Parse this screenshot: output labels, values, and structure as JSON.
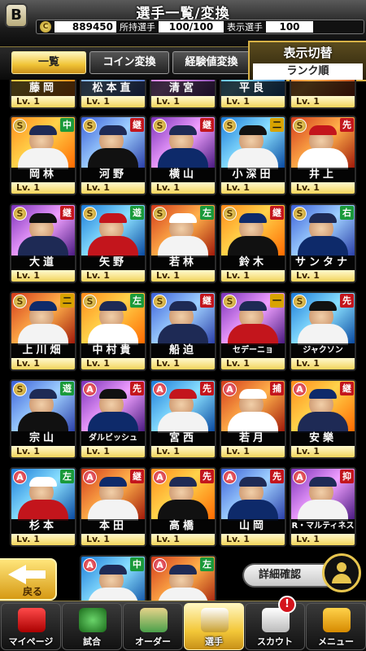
{
  "header": {
    "logo": "B",
    "title": "選手一覧/変換",
    "coins": "889450",
    "owned_label": "所持選手",
    "owned_value": "100/100",
    "shown_label": "表示選手",
    "shown_value": "100"
  },
  "tabs": [
    {
      "label": "一覧",
      "active": true
    },
    {
      "label": "コイン変換",
      "active": false
    },
    {
      "label": "経験値変換",
      "active": false
    }
  ],
  "display": {
    "title": "表示切替",
    "value": "ランク順"
  },
  "top_partial_row": [
    {
      "name": "藤岡",
      "lv": "Lv. 1"
    },
    {
      "name": "松本直",
      "lv": "Lv. 1"
    },
    {
      "name": "清宮",
      "lv": "Lv. 1"
    },
    {
      "name": "平良",
      "lv": "Lv. 1"
    },
    {
      "name": "",
      "lv": "Lv. 1"
    }
  ],
  "cards": [
    [
      {
        "rank": "S",
        "pos": "中",
        "name": "岡林",
        "lv": "Lv. 1"
      },
      {
        "rank": "S",
        "pos": "継",
        "name": "河野",
        "lv": "Lv. 1"
      },
      {
        "rank": "S",
        "pos": "継",
        "name": "横山",
        "lv": "Lv. 1"
      },
      {
        "rank": "S",
        "pos": "二",
        "name": "小深田",
        "lv": "Lv. 1"
      },
      {
        "rank": "S",
        "pos": "先",
        "name": "井上",
        "lv": "Lv. 1"
      }
    ],
    [
      {
        "rank": "S",
        "pos": "継",
        "name": "大道",
        "lv": "Lv. 1"
      },
      {
        "rank": "S",
        "pos": "遊",
        "name": "矢野",
        "lv": "Lv. 1"
      },
      {
        "rank": "S",
        "pos": "左",
        "name": "若林",
        "lv": "Lv. 1"
      },
      {
        "rank": "S",
        "pos": "継",
        "name": "鈴木",
        "lv": "Lv. 1"
      },
      {
        "rank": "S",
        "pos": "右",
        "name": "サンタナ",
        "lv": "Lv. 1"
      }
    ],
    [
      {
        "rank": "S",
        "pos": "二",
        "name": "上川畑",
        "lv": "Lv. 1"
      },
      {
        "rank": "S",
        "pos": "左",
        "name": "中村貴",
        "lv": "Lv. 1"
      },
      {
        "rank": "S",
        "pos": "継",
        "name": "船迫",
        "lv": "Lv. 1"
      },
      {
        "rank": "S",
        "pos": "一",
        "name": "セデーニョ",
        "lv": "Lv. 1"
      },
      {
        "rank": "S",
        "pos": "先",
        "name": "ジャクソン",
        "lv": "Lv. 1"
      }
    ],
    [
      {
        "rank": "S",
        "pos": "遊",
        "name": "宗山",
        "lv": "Lv. 1"
      },
      {
        "rank": "A",
        "pos": "先",
        "name": "ダルビッシュ",
        "lv": "Lv. 1"
      },
      {
        "rank": "A",
        "pos": "先",
        "name": "宮西",
        "lv": "Lv. 1"
      },
      {
        "rank": "A",
        "pos": "捕",
        "name": "若月",
        "lv": "Lv. 1"
      },
      {
        "rank": "A",
        "pos": "継",
        "name": "安樂",
        "lv": "Lv. 1"
      }
    ],
    [
      {
        "rank": "A",
        "pos": "左",
        "name": "杉本",
        "lv": "Lv. 1"
      },
      {
        "rank": "A",
        "pos": "継",
        "name": "本田",
        "lv": "Lv. 1"
      },
      {
        "rank": "A",
        "pos": "先",
        "name": "高橋",
        "lv": "Lv. 1"
      },
      {
        "rank": "A",
        "pos": "先",
        "name": "山岡",
        "lv": "Lv. 1"
      },
      {
        "rank": "A",
        "pos": "抑",
        "name": "R・マルティネス",
        "lv": "Lv. 1"
      }
    ]
  ],
  "bottom_partial_row": [
    {
      "rank": "A",
      "pos": "中"
    },
    {
      "rank": "A",
      "pos": "左"
    }
  ],
  "back_label": "戻る",
  "detail_label": "詳細確認",
  "nav": [
    {
      "label": "マイページ",
      "glyph": "a-logo-icon",
      "active": false
    },
    {
      "label": "試合",
      "glyph": "stadium-icon",
      "active": false
    },
    {
      "label": "オーダー",
      "glyph": "field-icon",
      "active": false
    },
    {
      "label": "選手",
      "glyph": "player-icon",
      "active": true
    },
    {
      "label": "スカウト",
      "glyph": "scout-icon",
      "active": false
    },
    {
      "label": "メニュー",
      "glyph": "menu-icon",
      "active": false
    }
  ],
  "notification": "!",
  "colors": {
    "gold": "#f0c436",
    "pos_green": "#1a9a3a",
    "pos_red": "#c3151c",
    "pos_yellow": "#d8a300"
  }
}
